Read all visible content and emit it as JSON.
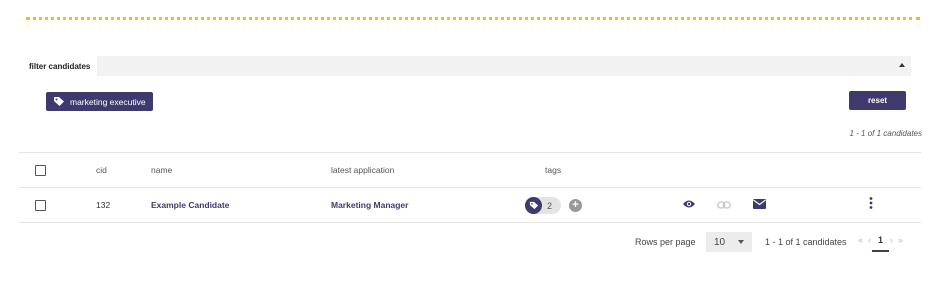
{
  "filter": {
    "label": "filter candidates",
    "active_chip": "marketing executive"
  },
  "actions": {
    "reset_label": "reset"
  },
  "summary": {
    "count_text": "1 - 1 of 1 candidates"
  },
  "table": {
    "columns": {
      "cid": "cid",
      "name": "name",
      "latest_application": "latest application",
      "tags": "tags"
    },
    "rows": [
      {
        "cid": "132",
        "name": "Example Candidate",
        "latest_application": "Marketing Manager",
        "tag_count": "2"
      }
    ]
  },
  "pagination": {
    "rows_per_page_label": "Rows per page",
    "rows_per_page_value": "10",
    "range_text": "1 - 1 of 1 candidates",
    "current_page": "1",
    "first_label": "«",
    "prev_label": "‹",
    "next_label": "›",
    "last_label": "»"
  },
  "colors": {
    "accent": "#3e3a6e",
    "divider_dots": "#e8c21a"
  },
  "icons": [
    "tag-icon",
    "caret-up-icon",
    "eye-icon",
    "link-icon",
    "mail-icon",
    "more-vertical-icon",
    "plus-icon",
    "dropdown-arrow-icon"
  ]
}
